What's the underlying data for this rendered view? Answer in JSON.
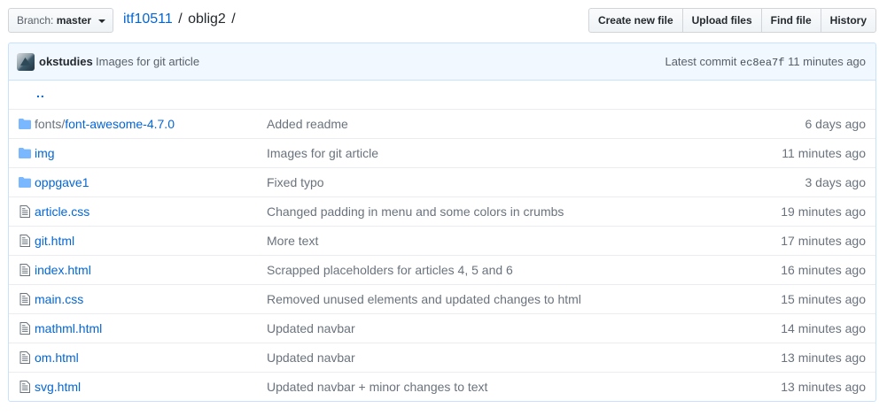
{
  "branch": {
    "prefix": "Branch:",
    "name": "master"
  },
  "breadcrumb": {
    "repo": "itf10511",
    "separator": "/",
    "current": "oblig2",
    "trailing": "/"
  },
  "actions": {
    "create_new_file": "Create new file",
    "upload_files": "Upload files",
    "find_file": "Find file",
    "history": "History"
  },
  "latest_commit": {
    "author": "okstudies",
    "message": "Images for git article",
    "label": "Latest commit",
    "sha": "ec8ea7f",
    "age": "11 minutes ago"
  },
  "parent_dir": "..",
  "files": [
    {
      "type": "dir",
      "prefix": "fonts/",
      "name": "font-awesome-4.7.0",
      "message": "Added readme",
      "age": "6 days ago"
    },
    {
      "type": "dir",
      "prefix": "",
      "name": "img",
      "message": "Images for git article",
      "age": "11 minutes ago"
    },
    {
      "type": "dir",
      "prefix": "",
      "name": "oppgave1",
      "message": "Fixed typo",
      "age": "3 days ago"
    },
    {
      "type": "file",
      "prefix": "",
      "name": "article.css",
      "message": "Changed padding in menu and some colors in crumbs",
      "age": "19 minutes ago"
    },
    {
      "type": "file",
      "prefix": "",
      "name": "git.html",
      "message": "More text",
      "age": "17 minutes ago"
    },
    {
      "type": "file",
      "prefix": "",
      "name": "index.html",
      "message": "Scrapped placeholders for articles 4, 5 and 6",
      "age": "16 minutes ago"
    },
    {
      "type": "file",
      "prefix": "",
      "name": "main.css",
      "message": "Removed unused elements and updated changes to html",
      "age": "15 minutes ago"
    },
    {
      "type": "file",
      "prefix": "",
      "name": "mathml.html",
      "message": "Updated navbar",
      "age": "14 minutes ago"
    },
    {
      "type": "file",
      "prefix": "",
      "name": "om.html",
      "message": "Updated navbar",
      "age": "13 minutes ago"
    },
    {
      "type": "file",
      "prefix": "",
      "name": "svg.html",
      "message": "Updated navbar + minor changes to text",
      "age": "13 minutes ago"
    }
  ],
  "colors": {
    "link": "#0366d6",
    "muted": "#6a737d",
    "folder_icon": "#79b8ff",
    "file_icon": "#6a737d",
    "commit_bg": "#f1f8ff"
  }
}
